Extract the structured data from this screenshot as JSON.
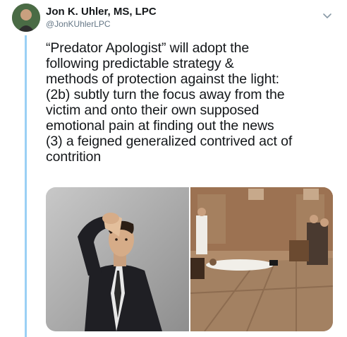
{
  "tweet": {
    "author_name": "Jon K. Uhler, MS, LPC",
    "author_handle": "@JonKUhlerLPC",
    "text_lines": [
      "“Predator Apologist” will adopt the",
      "following predictable strategy &",
      "methods of protection against the light:",
      "(2b) subtly turn the focus away from the",
      "victim and onto their own supposed",
      "emotional pain at finding out the news",
      "(3) a feigned generalized contrived act of",
      "contrition"
    ]
  },
  "icons": {
    "menu": "chevron-down-icon",
    "avatar": "avatar"
  },
  "colors": {
    "thread_line": "#9ad0f5",
    "name": "#14171a",
    "handle": "#657786"
  }
}
